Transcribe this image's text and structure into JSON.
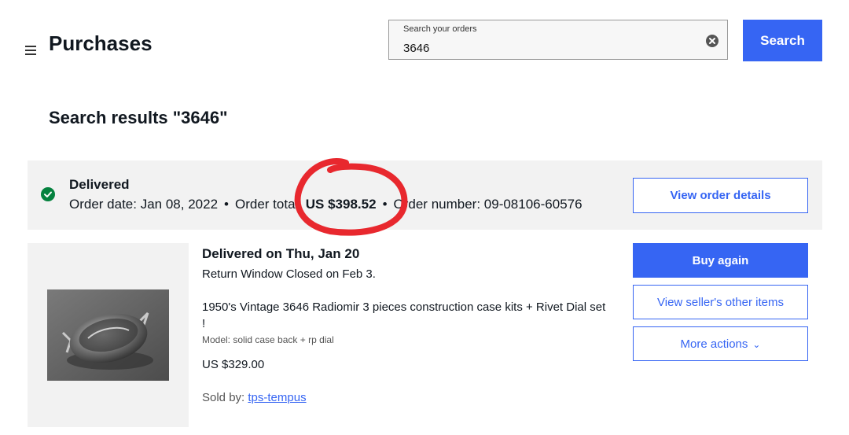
{
  "header": {
    "title": "Purchases",
    "menu_icon": "hamburger-menu-icon"
  },
  "search": {
    "label": "Search your orders",
    "value": "3646",
    "button_label": "Search",
    "clear_icon": "clear-circle-icon"
  },
  "results_title": "Search results \"3646\"",
  "order": {
    "status": "Delivered",
    "status_icon": "check-circle-icon",
    "order_date_label": "Order date: Jan 08, 2022",
    "order_total_label": "Order total:",
    "order_total_value": "US $398.52",
    "order_number_label": "Order number: 09-08106-60576",
    "separator": "•",
    "view_details_label": "View order details"
  },
  "item": {
    "delivered_on": "Delivered on Thu, Jan 20",
    "return_window": "Return Window Closed on Feb 3.",
    "title": "1950's Vintage 3646 Radiomir 3 pieces construction case kits + Rivet Dial set !",
    "model": "Model: solid case back + rp dial",
    "price": "US $329.00",
    "sold_by_label": "Sold by:",
    "seller": "tps-tempus",
    "image_icon": "watch-case-photo"
  },
  "actions": {
    "buy_again": "Buy again",
    "seller_items": "View seller's other items",
    "more_actions": "More actions",
    "chevron": "⌄"
  },
  "colors": {
    "accent": "#3665f3",
    "success": "#05823f",
    "annotation": "#e8282e",
    "band": "#f2f2f2"
  }
}
